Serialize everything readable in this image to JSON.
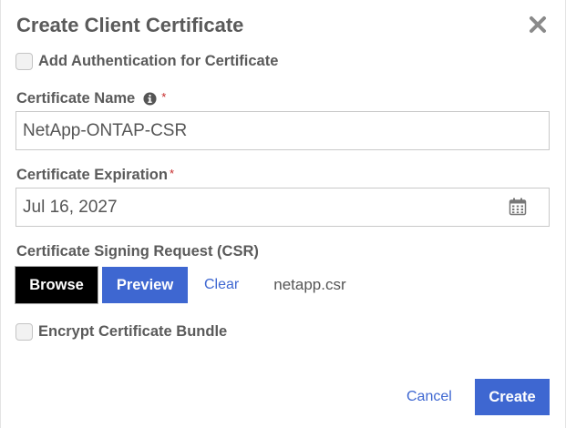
{
  "dialog": {
    "title": "Create Client Certificate",
    "close_icon": "close-icon"
  },
  "auth_option": {
    "label": "Add Authentication for Certificate",
    "checked": false
  },
  "certificate_name": {
    "label": "Certificate Name",
    "required_mark": "*",
    "info_icon": "info-icon",
    "value": "NetApp-ONTAP-CSR"
  },
  "certificate_expiration": {
    "label": "Certificate Expiration",
    "required_mark": "*",
    "value": "Jul 16, 2027",
    "calendar_icon": "calendar-icon"
  },
  "csr": {
    "label": "Certificate Signing Request (CSR)",
    "browse_label": "Browse",
    "preview_label": "Preview",
    "clear_label": "Clear",
    "filename": "netapp.csr"
  },
  "encrypt_option": {
    "label": "Encrypt Certificate Bundle",
    "checked": false
  },
  "footer": {
    "cancel_label": "Cancel",
    "create_label": "Create"
  },
  "colors": {
    "accent": "#3e67d1",
    "browse": "#000000",
    "required": "#c62828",
    "text": "#5a5a5a"
  }
}
